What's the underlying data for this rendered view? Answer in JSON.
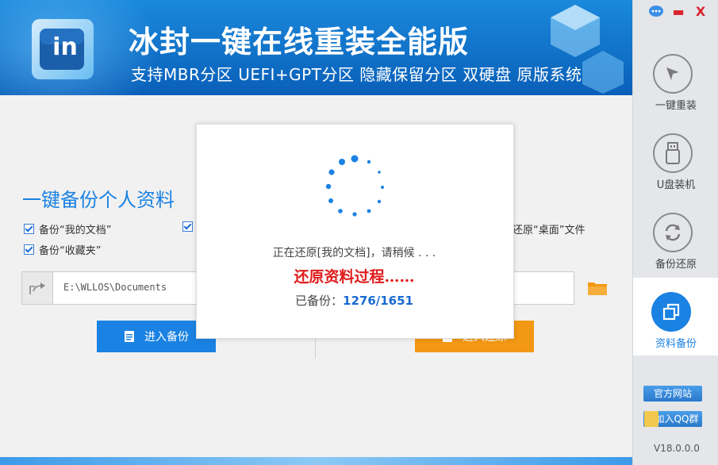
{
  "header": {
    "title": "冰封一键在线重装全能版",
    "subtitle": "支持MBR分区  UEFI+GPT分区  隐藏保留分区  双硬盘  原版系统",
    "logo_text": "in"
  },
  "window_controls": {
    "chat_icon": "chat-bubble-icon",
    "minimize": "▬",
    "close": "X"
  },
  "sidebar": {
    "items": [
      {
        "label": "一键重装",
        "icon": "cursor-arrow-icon"
      },
      {
        "label": "U盘装机",
        "icon": "usb-icon"
      },
      {
        "label": "备份还原",
        "icon": "refresh-icon"
      },
      {
        "label": "资料备份",
        "icon": "copy-icon",
        "active": true
      }
    ],
    "official_site": "官方网站",
    "join_qq": "加入QQ群",
    "version": "V18.0.0.0"
  },
  "main": {
    "section_title": "一键备份个人资料",
    "checks": [
      {
        "label": "备份“我的文档”",
        "checked": true
      },
      {
        "label": "备份“收藏夹”",
        "checked": true
      },
      {
        "label": "",
        "checked": true
      },
      {
        "label": "还原“桌面”文件",
        "checked": true
      }
    ],
    "path": "E:\\WLLOS\\Documents",
    "enter_backup": "进入备份",
    "enter_restore": "进入还原"
  },
  "modal": {
    "status": "正在还原[我的文档]，请稍候 . . .",
    "progress": "还原资料过程……",
    "count_label": "已备份：",
    "count_value": "1276/1651"
  },
  "colors": {
    "accent": "#1a82e2",
    "orange": "#f39814",
    "red": "#e01b1b"
  }
}
